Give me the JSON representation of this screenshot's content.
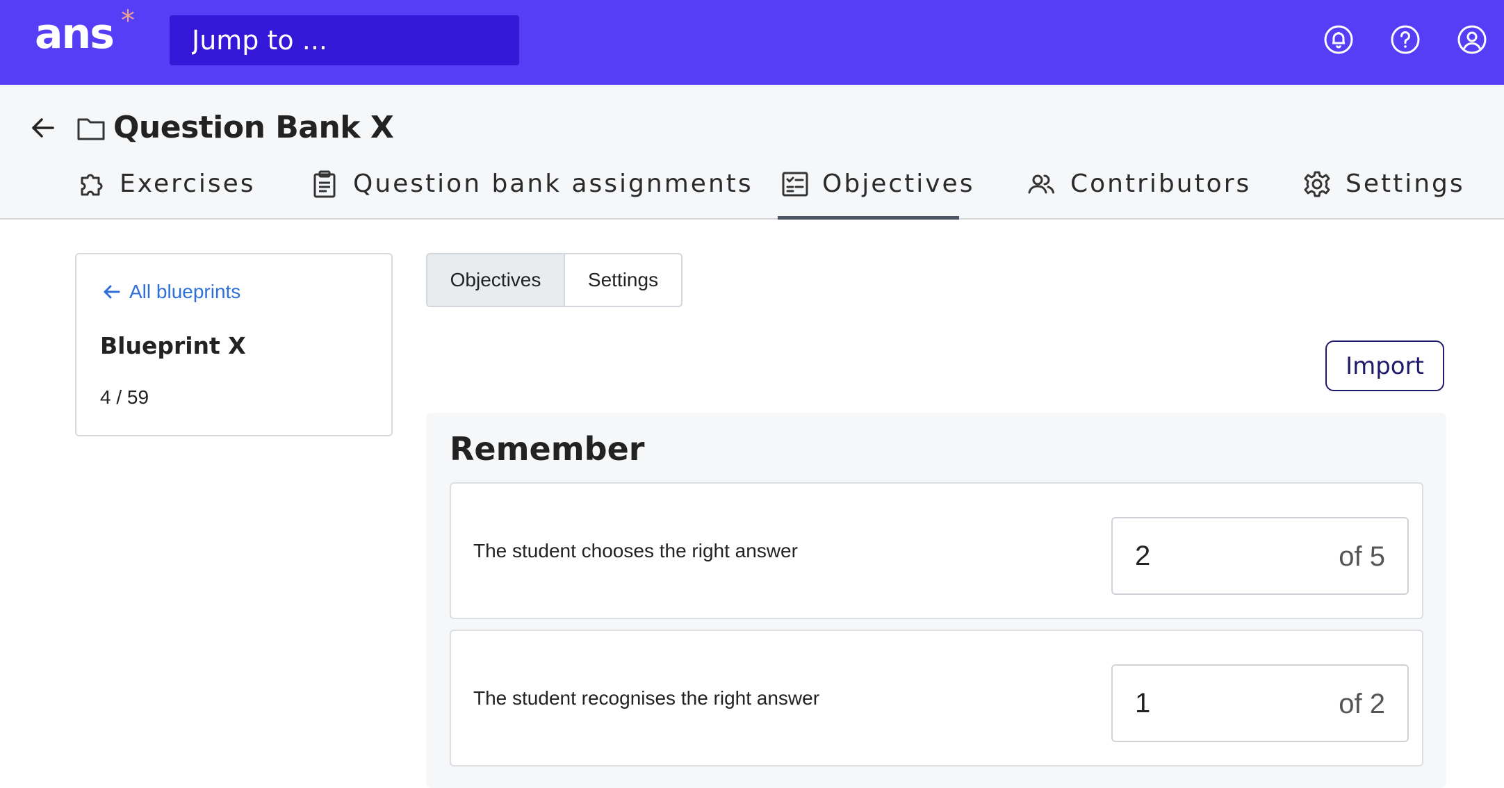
{
  "app": {
    "logo_text": "ans",
    "logo_mark": "*",
    "search_placeholder": "Jump to ...",
    "header_icons": [
      "notifications-icon",
      "help-icon",
      "account-icon"
    ],
    "brand_color": "#553ef5"
  },
  "page": {
    "title": "Question Bank X",
    "tabs": [
      {
        "label": "Exercises",
        "icon": "puzzle-icon",
        "active": false
      },
      {
        "label": "Question bank assignments",
        "icon": "clipboard-icon",
        "active": false
      },
      {
        "label": "Objectives",
        "icon": "checklist-icon",
        "active": true
      },
      {
        "label": "Contributors",
        "icon": "people-icon",
        "active": false
      },
      {
        "label": "Settings",
        "icon": "gear-icon",
        "active": false
      }
    ]
  },
  "sidebar": {
    "back_link": "All blueprints",
    "blueprint_name": "Blueprint X",
    "count": "4 / 59"
  },
  "subtabs": [
    {
      "label": "Objectives",
      "active": true
    },
    {
      "label": "Settings",
      "active": false
    }
  ],
  "import_label": "Import",
  "section": {
    "title": "Remember",
    "objectives": [
      {
        "text": "The student chooses the right answer",
        "value": "2",
        "of": "of 5"
      },
      {
        "text": "The student recognises the right answer",
        "value": "1",
        "of": "of 2"
      }
    ]
  }
}
